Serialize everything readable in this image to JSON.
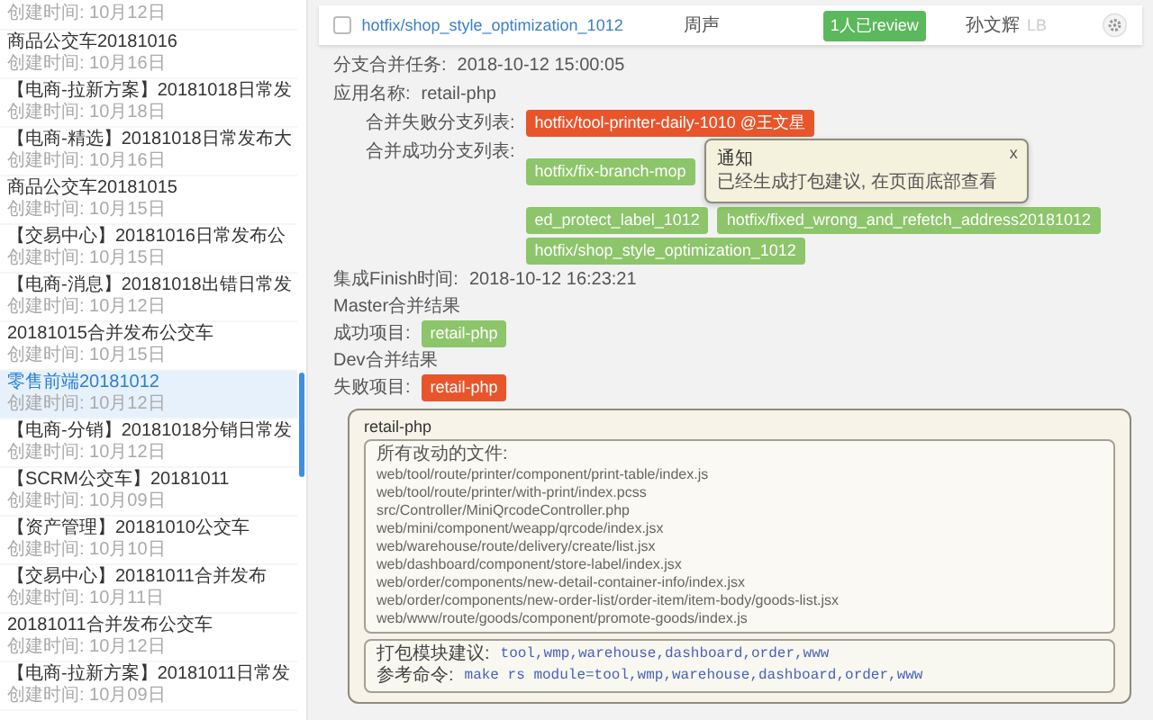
{
  "sidebar": {
    "items": [
      {
        "subtitle": "创建时间: 10月12日",
        "selected": false
      },
      {
        "title": "商品公交车20181016",
        "subtitle": "创建时间: 10月16日",
        "selected": false
      },
      {
        "title": "【电商-拉新方案】20181018日常发",
        "subtitle": "创建时间: 10月18日",
        "selected": false
      },
      {
        "title": "【电商-精选】20181018日常发布大",
        "subtitle": "创建时间: 10月16日",
        "selected": false
      },
      {
        "title": "商品公交车20181015",
        "subtitle": "创建时间: 10月15日",
        "selected": false
      },
      {
        "title": "【交易中心】20181016日常发布公",
        "subtitle": "创建时间: 10月15日",
        "selected": false
      },
      {
        "title": "【电商-消息】20181018出错日常发",
        "subtitle": "创建时间: 10月12日",
        "selected": false
      },
      {
        "title": "20181015合并发布公交车",
        "subtitle": "创建时间: 10月15日",
        "selected": false
      },
      {
        "title": "零售前端20181012",
        "subtitle": "创建时间: 10月12日",
        "selected": true
      },
      {
        "title": "【电商-分销】20181018分销日常发",
        "subtitle": "创建时间: 10月12日",
        "selected": false
      },
      {
        "title": "【SCRM公交车】20181011",
        "subtitle": "创建时间: 10月09日",
        "selected": false
      },
      {
        "title": "【资产管理】20181010公交车",
        "subtitle": "创建时间: 10月10日",
        "selected": false
      },
      {
        "title": "【交易中心】20181011合并发布",
        "subtitle": "创建时间: 10月11日",
        "selected": false
      },
      {
        "title": "20181011合并发布公交车",
        "subtitle": "创建时间: 10月12日",
        "selected": false
      },
      {
        "title": "【电商-拉新方案】20181011日常发",
        "subtitle": "创建时间: 10月09日",
        "selected": false
      }
    ]
  },
  "task_row": {
    "checked": false,
    "branch": "hotfix/shop_style_optimization_1012",
    "author": "周声",
    "review_badge": "1人已review",
    "reviewer": "孙文辉",
    "reviewer_note": "LB"
  },
  "details": [
    {
      "kind": "field",
      "label": "分支合并任务:",
      "value": "2018-10-12 15:00:05"
    },
    {
      "kind": "field",
      "label": "应用名称:",
      "value": "retail-php"
    },
    {
      "kind": "branch_list",
      "label": "合并失败分支列表:",
      "tags": [
        {
          "text": "hotfix/tool-printer-daily-1010 @王文星",
          "color": "#e8552b"
        }
      ]
    },
    {
      "kind": "branch_list",
      "label": "合并成功分支列表:",
      "tags": [
        {
          "text": "hotfix/fix-branch-mop",
          "color": "#8cc56a"
        },
        {
          "text": "ed_protect_label_1012",
          "color": "#8cc56a"
        },
        {
          "text": "hotfix/fixed_wrong_and_refetch_address20181012",
          "color": "#8cc56a"
        },
        {
          "text": "hotfix/shop_style_optimization_1012",
          "color": "#8cc56a"
        }
      ],
      "notification": {
        "title": "通知",
        "message": "已经生成打包建议, 在页面底部查看",
        "close": "x"
      }
    },
    {
      "kind": "field",
      "label": "集成Finish时间:",
      "value": "2018-10-12 16:23:21"
    },
    {
      "kind": "heading",
      "label": "Master合并结果"
    },
    {
      "kind": "project_list",
      "label": "成功项目:",
      "tags": [
        {
          "text": "retail-php",
          "color": "#8cc56a"
        }
      ]
    },
    {
      "kind": "heading",
      "label": "Dev合并结果"
    },
    {
      "kind": "project_list",
      "label": "失败项目:",
      "tags": [
        {
          "text": "retail-php",
          "color": "#e8552b"
        }
      ]
    }
  ],
  "result_panel": {
    "title": "retail-php",
    "files_heading": "所有改动的文件:",
    "files": [
      "web/tool/route/printer/component/print-table/index.js",
      "web/tool/route/printer/with-print/index.pcss",
      "src/Controller/MiniQrcodeController.php",
      "web/mini/component/weapp/qrcode/index.jsx",
      "web/warehouse/route/delivery/create/list.jsx",
      "web/dashboard/component/store-label/index.jsx",
      "web/order/components/new-detail-container-info/index.jsx",
      "web/order/components/new-order-list/order-item/item-body/goods-list.jsx",
      "web/www/route/goods/component/promote-goods/index.js"
    ],
    "suggestions": [
      {
        "label": "打包模块建议:",
        "value": "tool,wmp,warehouse,dashboard,order,www"
      },
      {
        "label": "参考命令:",
        "value": "make rs module=tool,wmp,warehouse,dashboard,order,www"
      }
    ]
  }
}
